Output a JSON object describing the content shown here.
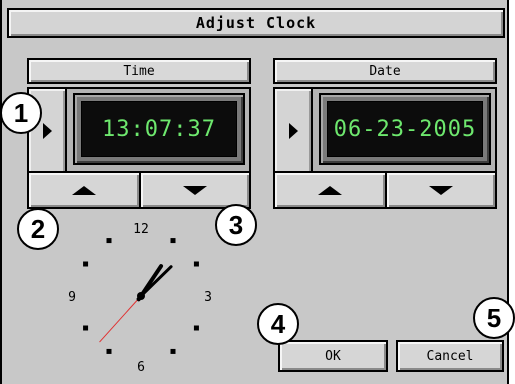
{
  "window": {
    "title": "Adjust Clock"
  },
  "time_panel": {
    "header": "Time",
    "value": "13:07:37",
    "select_icon": "play-arrow-icon",
    "up_icon": "triangle-up-icon",
    "down_icon": "triangle-down-icon"
  },
  "date_panel": {
    "header": "Date",
    "value": "06-23-2005",
    "select_icon": "play-arrow-icon",
    "up_icon": "triangle-up-icon",
    "down_icon": "triangle-down-icon"
  },
  "analog_clock": {
    "numerals": {
      "n12": "12",
      "n3": "3",
      "n6": "6",
      "n9": "9"
    },
    "hours": 13,
    "minutes": 7,
    "seconds": 37
  },
  "buttons": {
    "ok": "OK",
    "cancel": "Cancel"
  },
  "callouts": [
    "1",
    "2",
    "3",
    "4",
    "5"
  ],
  "colors": {
    "panel": "#c8c8c8",
    "lcd_bg": "#0c0c0c",
    "lcd_text": "#6ee86e",
    "second_hand": "#e03030"
  }
}
